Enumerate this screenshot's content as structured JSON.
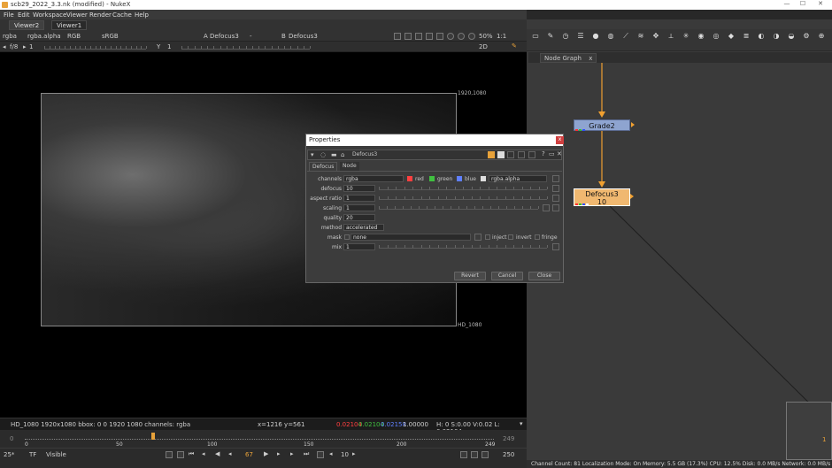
{
  "window": {
    "title": "scb29_2022_3.3.nk (modified) - NukeX",
    "controls": [
      "—",
      "☐",
      "✕"
    ]
  },
  "menu": [
    "File",
    "Edit",
    "Workspace",
    "Viewer",
    "Render",
    "Cache",
    "Help"
  ],
  "viewer_tabs": [
    "Viewer2",
    "Viewer1"
  ],
  "viewer_toolbar": {
    "channels": "rgba",
    "alpha": "rgba.alpha",
    "display": "RGB",
    "lut": "sRGB",
    "input_a_label": "A",
    "input_a": "Defocus3",
    "blend": "-",
    "input_b_label": "B",
    "input_b": "Defocus3",
    "zoom": "50%",
    "proxy": "1:1"
  },
  "viewer_toolbar2": {
    "fstop": "f/8",
    "gain": "1",
    "gamma_label": "Y",
    "gamma": "1",
    "mode": "2D"
  },
  "viewer": {
    "fmt_top": "1920,1080",
    "fmt_bottom": "HD_1080"
  },
  "status": {
    "info": "HD_1080 1920x1080  bbox: 0 0 1920 1080 channels: rgba",
    "coords": "x=1216 y=561",
    "r": "0.02104",
    "g": "0.02104",
    "b": "0.02158",
    "a": "1.00000",
    "hsvl": "H:  0 S:0.00 V:0.02   L: 0.02104"
  },
  "timeline": {
    "start": "0",
    "end": "249",
    "left_field": "0",
    "right_field": "249",
    "ticks": [
      "0",
      "50",
      "100",
      "150",
      "200",
      "249"
    ],
    "current_frame_fraction": 0.27
  },
  "time_controls": {
    "fps": "25*",
    "tf": "TF",
    "visible": "Visible",
    "frame": "67",
    "increment": "10",
    "end_frame": "250"
  },
  "node_graph": {
    "tab": "Node Graph",
    "close": "x"
  },
  "nodes": {
    "grade": {
      "name": "Grade2"
    },
    "defocus": {
      "name": "Defocus3",
      "sub": "10"
    }
  },
  "properties": {
    "title": "Properties",
    "close": "x",
    "node_name": "Defocus3",
    "tabs": [
      "Defocus",
      "Node"
    ],
    "channels_label": "channels",
    "channels": "rgba",
    "ch_red": "red",
    "ch_green": "green",
    "ch_blue": "blue",
    "ch_alpha": "rgba.alpha",
    "defocus_label": "defocus",
    "defocus": "10",
    "aspect_label": "aspect ratio",
    "aspect": "1",
    "scaling_label": "scaling",
    "scaling": "1",
    "quality_label": "quality",
    "quality": "20",
    "method_label": "method",
    "method": "accelerated",
    "mask_label": "mask",
    "mask": "none",
    "inject": "inject",
    "invert": "invert",
    "fringe": "fringe",
    "mix_label": "mix",
    "mix": "1",
    "revert": "Revert",
    "cancel": "Cancel",
    "close_btn": "Close"
  },
  "bottom_status": "Channel Count: 81  Localization Mode: On  Memory: 5.5 GB (17.3%)  CPU: 12.5%  Disk: 0.0 MB/s  Network: 0.0 MB/s",
  "colors": {
    "accent": "#e8a23a",
    "grade_node": "#8ea4d0",
    "defocus_node": "#f0b870",
    "red": "#ff4040",
    "green": "#40c040",
    "blue": "#6080ff"
  }
}
